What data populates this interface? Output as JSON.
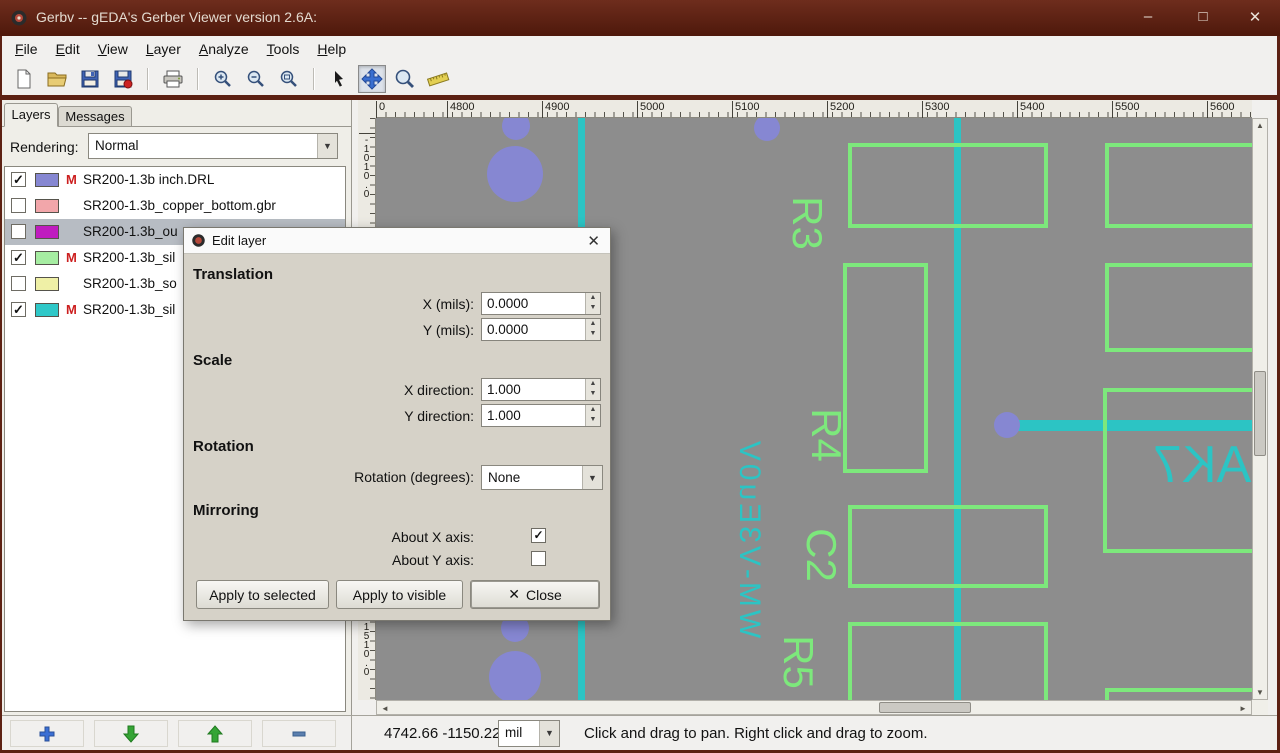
{
  "window": {
    "title": "Gerbv -- gEDA's Gerber Viewer version 2.6A:",
    "minimize_icon": "–",
    "maximize_icon": "□",
    "close_icon": "✕"
  },
  "menubar": {
    "items": [
      "File",
      "Edit",
      "View",
      "Layer",
      "Analyze",
      "Tools",
      "Help"
    ]
  },
  "toolbar": {
    "tools": [
      "new",
      "open",
      "save-project",
      "save-layer",
      "print",
      "zoom-in",
      "zoom-out",
      "zoom-fit",
      "pointer",
      "pan",
      "zoom-click",
      "measure"
    ],
    "active_tool": "pan"
  },
  "sidebar": {
    "tabs": {
      "layers": "Layers",
      "messages": "Messages"
    },
    "rendering_label": "Rendering:",
    "rendering_value": "Normal",
    "layers": [
      {
        "check": "✓",
        "swatch": "#8687d2",
        "flag": "M",
        "name": "SR200-1.3b inch.DRL",
        "selected": false
      },
      {
        "check": "",
        "swatch": "#f2a6aa",
        "flag": "",
        "name": "SR200-1.3b_copper_bottom.gbr",
        "selected": false
      },
      {
        "check": "",
        "swatch": "#bf1cbf",
        "flag": "",
        "name": "SR200-1.3b_ou",
        "selected": true
      },
      {
        "check": "✓",
        "swatch": "#a6eda2",
        "flag": "M",
        "name": "SR200-1.3b_sil",
        "selected": false
      },
      {
        "check": "",
        "swatch": "#eff0a6",
        "flag": "",
        "name": "SR200-1.3b_so",
        "selected": false
      },
      {
        "check": "✓",
        "swatch": "#2fc8c8",
        "flag": "M",
        "name": "SR200-1.3b_sil",
        "selected": false
      }
    ]
  },
  "dialog": {
    "title": "Edit layer",
    "translation": {
      "heading": "Translation",
      "x_label": "X (mils):",
      "x_value": "0.0000",
      "y_label": "Y (mils):",
      "y_value": "0.0000"
    },
    "scale": {
      "heading": "Scale",
      "x_label": "X direction:",
      "x_value": "1.000",
      "y_label": "Y direction:",
      "y_value": "1.000"
    },
    "rotation": {
      "heading": "Rotation",
      "label": "Rotation (degrees):",
      "value": "None"
    },
    "mirroring": {
      "heading": "Mirroring",
      "x_label": "About X axis:",
      "x_check": "✓",
      "y_label": "About Y axis:",
      "y_check": ""
    },
    "buttons": {
      "apply_selected": "Apply to selected",
      "apply_visible": "Apply to visible",
      "close": "Close"
    }
  },
  "canvas": {
    "ruler_top": [
      "0",
      "4800",
      "4900",
      "5000",
      "5100",
      "5200",
      "5300",
      "5400",
      "5500",
      "5600"
    ],
    "ruler_left": [
      "-1010.0",
      "-1510.0"
    ],
    "silk_labels": [
      "R3",
      "R4",
      "C2",
      "R5"
    ],
    "teal_labels": {
      "vertical_mirrored": "WM-V3Eu0V",
      "horizontal_mirrored": "AK7"
    }
  },
  "statusbar": {
    "coordinates": "4742.66 -1150.22",
    "units": "mil",
    "hint": "Click and drag to pan. Right click and drag to zoom."
  },
  "icons": {
    "dropdown": "▼",
    "spin_up": "▲",
    "spin_down": "▼",
    "scroll_left": "◄",
    "scroll_right": "►",
    "scroll_up": "▲",
    "scroll_down": "▼",
    "close": "✕"
  },
  "colors": {
    "titlebar": "#5c2113",
    "canvas_bg": "#8d8d8d",
    "silk_green": "#7de87c",
    "trace_teal": "#2cc4c4",
    "drill_purple": "#8687d2",
    "selection": "#b7bcc3"
  }
}
